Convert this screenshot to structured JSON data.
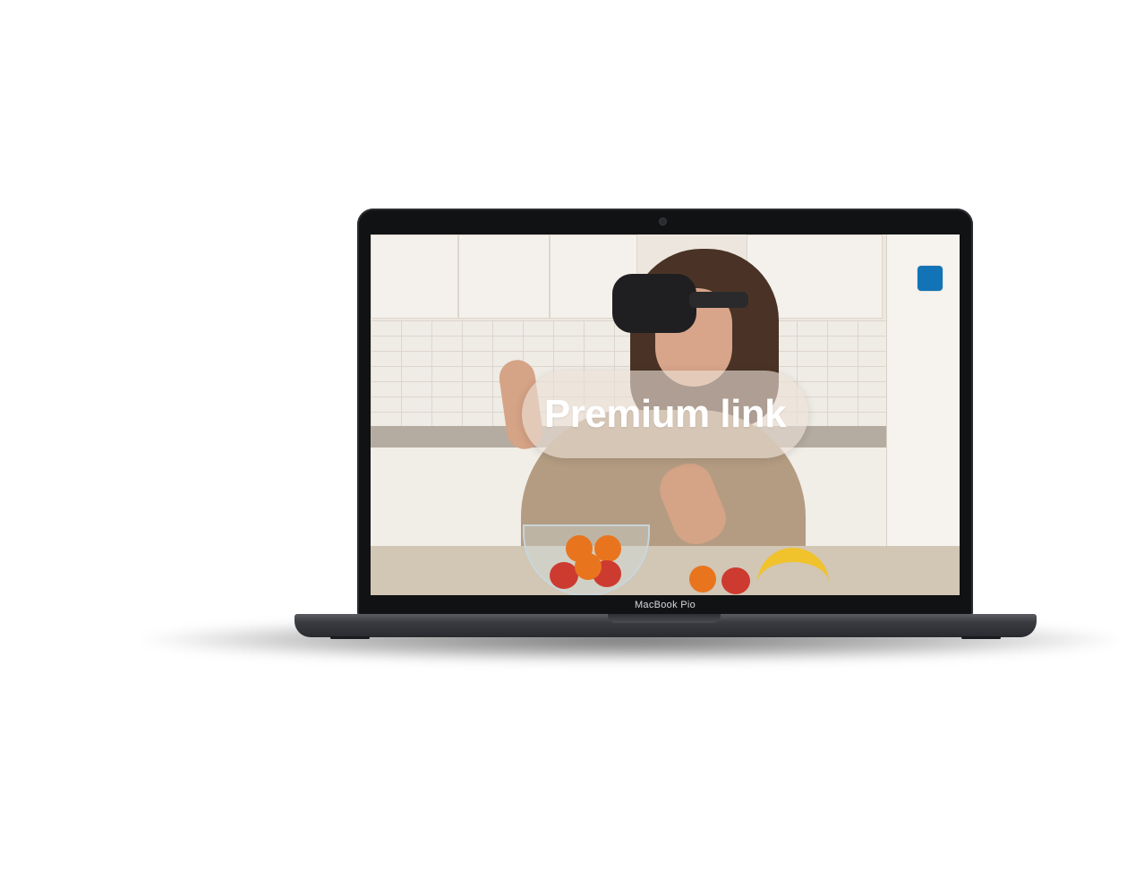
{
  "screen": {
    "link_label": "Premium link",
    "accent_color": "#1274b7"
  },
  "device": {
    "model_label": "MacBook Pio"
  },
  "icons": {
    "corner_button": "square-icon"
  }
}
